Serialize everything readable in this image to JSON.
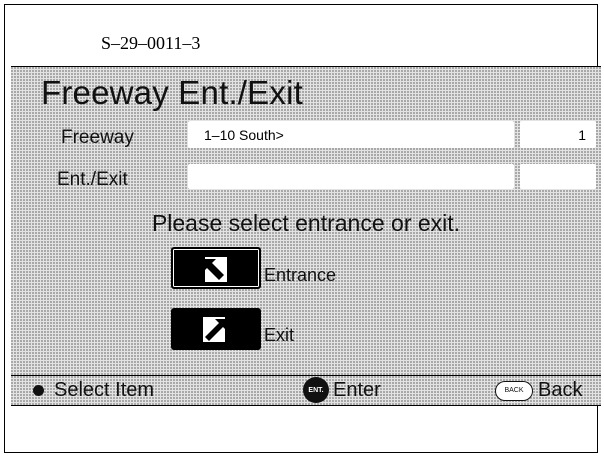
{
  "figure_code": "S–29–0011–3",
  "header": {
    "title": "Freeway Ent./Exit"
  },
  "rows": {
    "freeway": {
      "label": "Freeway",
      "value": "1–10 South>",
      "number": "1"
    },
    "ent_exit": {
      "label": "Ent./Exit",
      "value": "",
      "number": ""
    }
  },
  "prompt": "Please select entrance or exit.",
  "options": {
    "entrance": {
      "label": "Entrance",
      "icon": "entrance-arrow-icon"
    },
    "exit": {
      "label": "Exit",
      "icon": "exit-arrow-icon"
    }
  },
  "bottom_bar": {
    "select": {
      "label": "Select Item",
      "icon": "dot-icon"
    },
    "enter": {
      "label": "Enter",
      "icon_text": "ENT.",
      "icon": "enter-button-icon"
    },
    "back": {
      "label": "Back",
      "icon_text": "BACK",
      "icon": "back-button-icon"
    }
  }
}
